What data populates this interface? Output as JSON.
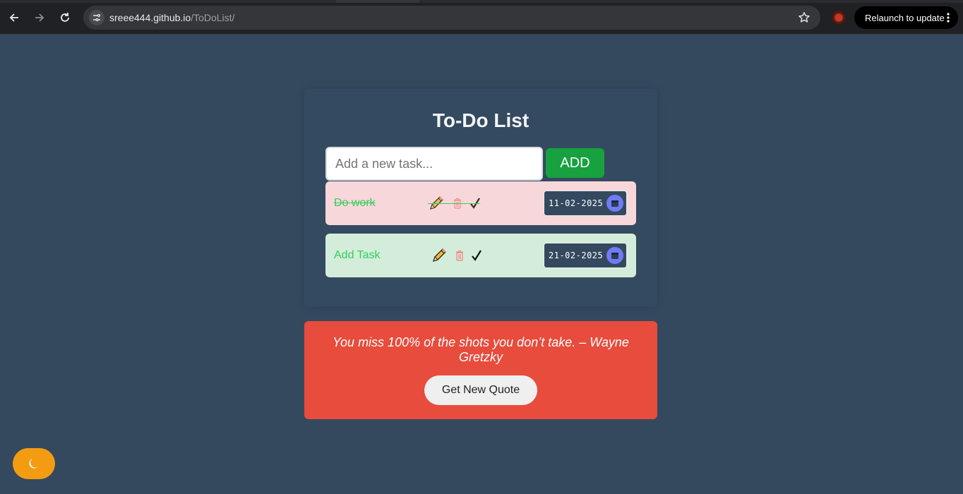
{
  "browser": {
    "url_host": "sreee444.github.io",
    "url_path": "/ToDoList/",
    "relaunch_label": "Relaunch to update",
    "icons": [
      "back-icon",
      "forward-icon",
      "reload-icon",
      "site-info-icon",
      "bookmark-star-icon",
      "extension-icon",
      "more-vert-icon"
    ]
  },
  "app": {
    "title": "To-Do List",
    "input": {
      "placeholder": "Add a new task...",
      "value": ""
    },
    "add_label": "ADD",
    "tasks": [
      {
        "text": "Do work",
        "date": "11-02-2025",
        "completed": true
      },
      {
        "text": "Add Task",
        "date": "21-02-2025",
        "completed": false
      }
    ],
    "task_icons": [
      "pencil-icon",
      "trash-icon",
      "check-icon",
      "calendar-icon"
    ]
  },
  "quote": {
    "text": "You miss 100% of the shots you don’t take. – Wayne Gretzky",
    "button_label": "Get New Quote"
  },
  "theme_toggle": {
    "icon": "moon-icon"
  },
  "colors": {
    "page_bg": "#34495e",
    "add_button": "#17a13f",
    "completed_task_bg": "#f8d7da",
    "open_task_bg": "#d4edda",
    "task_text": "#2fd05a",
    "quote_bg": "#e74c3c",
    "theme_toggle": "#f39c12",
    "calendar_accent": "#6f7cf7"
  }
}
